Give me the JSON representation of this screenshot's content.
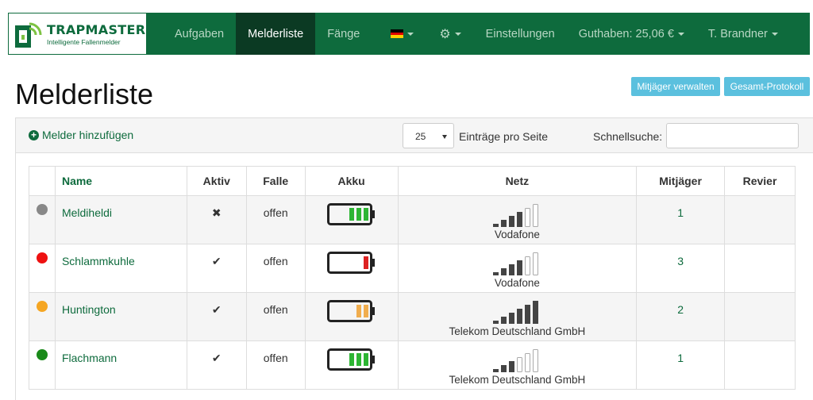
{
  "brand": {
    "title": "TRAPMASTER",
    "subtitle": "Intelligente Fallenmelder"
  },
  "nav": {
    "items": [
      {
        "label": "Aufgaben",
        "active": false
      },
      {
        "label": "Melderliste",
        "active": true
      },
      {
        "label": "Fänge",
        "active": false
      }
    ],
    "language_flag": "de-flag-icon",
    "settings_icon": "gear-icon",
    "settings_label": "Einstellungen",
    "balance_label": "Guthaben: 25,06 €",
    "user_label": "T. Brandner"
  },
  "page": {
    "title": "Melderliste"
  },
  "buttons": {
    "hunters": "Mitjäger verwalten",
    "protocol": "Gesamt-Protokoll"
  },
  "toolbar": {
    "add_label": "Melder hinzufügen",
    "page_size": "25",
    "page_size_label": "Einträge pro Seite",
    "search_label": "Schnellsuche:",
    "search_value": ""
  },
  "table": {
    "headers": {
      "status": "",
      "name": "Name",
      "active": "Aktiv",
      "trap": "Falle",
      "battery": "Akku",
      "network": "Netz",
      "hunters": "Mitjäger",
      "area": "Revier"
    },
    "rows": [
      {
        "status_color": "#888888",
        "name": "Meldiheldi",
        "active": "✖",
        "trap": "offen",
        "battery_level": 3,
        "battery_color": "#2db533",
        "signal_bars": 4,
        "network": "Vodafone",
        "hunters": "1",
        "area": ""
      },
      {
        "status_color": "#ee1111",
        "name": "Schlammkuhle",
        "active": "✔",
        "trap": "offen",
        "battery_level": 1,
        "battery_color": "#dd2222",
        "signal_bars": 4,
        "network": "Vodafone",
        "hunters": "3",
        "area": ""
      },
      {
        "status_color": "#f5a623",
        "name": "Huntington",
        "active": "✔",
        "trap": "offen",
        "battery_level": 2,
        "battery_color": "#f0ad4e",
        "signal_bars": 6,
        "network": "Telekom Deutschland GmbH",
        "hunters": "2",
        "area": ""
      },
      {
        "status_color": "#1a8a1a",
        "name": "Flachmann",
        "active": "✔",
        "trap": "offen",
        "battery_level": 3,
        "battery_color": "#2db533",
        "signal_bars": 3,
        "network": "Telekom Deutschland GmbH",
        "hunters": "1",
        "area": ""
      }
    ]
  },
  "colors": {
    "brand": "#0e6b3d",
    "navbar_active": "#0b3a23",
    "info_button": "#5bc0de"
  }
}
